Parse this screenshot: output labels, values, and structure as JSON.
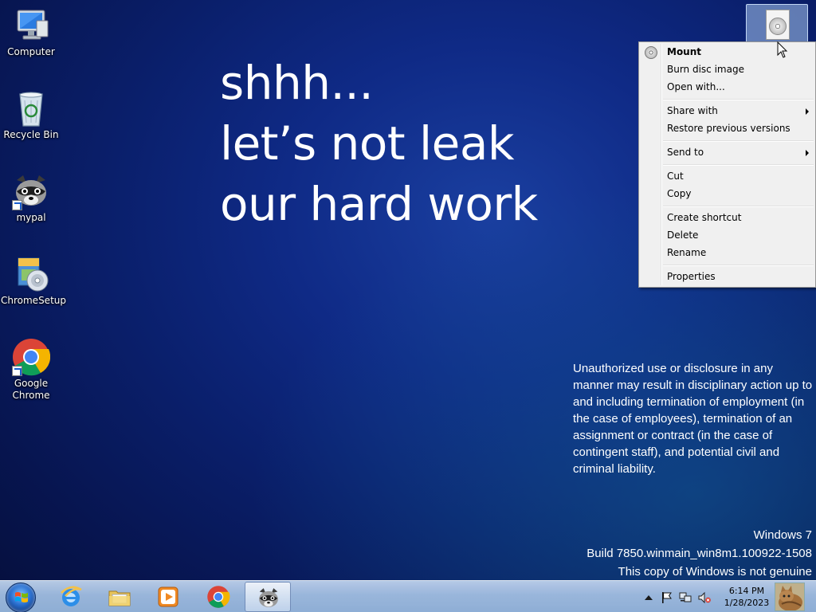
{
  "desktop": {
    "icons": [
      {
        "label": "Computer",
        "icon": "computer-icon"
      },
      {
        "label": "Recycle Bin",
        "icon": "recycle-bin-icon"
      },
      {
        "label": "mypal",
        "icon": "raccoon-icon"
      },
      {
        "label": "ChromeSetup",
        "icon": "installer-icon"
      },
      {
        "label": "Google Chrome",
        "icon": "chrome-icon"
      }
    ],
    "slogan": [
      "shhh...",
      "let’s not leak",
      "our hard work"
    ],
    "disclaimer": "Unauthorized use or disclosure in any manner may result in disciplinary action up to and including termination of employment (in the case of employees), termination of an assignment or contract (in the case of contingent staff), and potential civil and criminal liability.",
    "watermark": {
      "os": "Windows 7",
      "build": "Build 7850.winmain_win8m1.100922-1508",
      "genuine": "This copy of Windows is not genuine"
    },
    "selected_file_icon": "disc-image-file-icon"
  },
  "context_menu": {
    "items": [
      {
        "label": "Mount",
        "bold": true,
        "icon": "disc-icon"
      },
      {
        "label": "Burn disc image"
      },
      {
        "label": "Open with..."
      },
      {
        "label": "Share with",
        "submenu": true
      },
      {
        "label": "Restore previous versions"
      },
      {
        "label": "Send to",
        "submenu": true
      },
      {
        "label": "Cut"
      },
      {
        "label": "Copy"
      },
      {
        "label": "Create shortcut"
      },
      {
        "label": "Delete"
      },
      {
        "label": "Rename"
      },
      {
        "label": "Properties"
      }
    ]
  },
  "taskbar": {
    "start_icon": "windows-logo-icon",
    "pinned": [
      {
        "name": "internet-explorer",
        "icon": "ie-icon"
      },
      {
        "name": "windows-explorer",
        "icon": "folder-icon"
      },
      {
        "name": "media-player",
        "icon": "media-player-icon"
      },
      {
        "name": "google-chrome",
        "icon": "chrome-icon"
      },
      {
        "name": "mypal",
        "icon": "raccoon-icon",
        "active": true
      }
    ],
    "tray": {
      "icons": [
        "show-hidden-icons-arrow",
        "action-center-flag-icon",
        "network-icon",
        "volume-muted-icon"
      ],
      "time": "6:14 PM",
      "date": "1/28/2023"
    }
  },
  "colors": {
    "desktop_bg": "#0c2475",
    "menu_bg": "#f0f0f0",
    "taskbar": "#a8c3e6"
  }
}
